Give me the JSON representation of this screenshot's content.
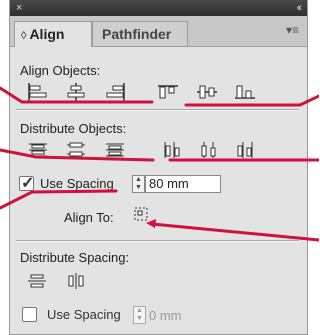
{
  "titlebar": {
    "close_glyph": "×",
    "collapse_glyph": "‹‹"
  },
  "tabs": [
    {
      "label": "Align",
      "arrows": "◊",
      "active": true
    },
    {
      "label": "Pathfinder",
      "active": false
    }
  ],
  "panel_menu_glyph": "▾≡",
  "align_objects": {
    "label": "Align Objects:",
    "icons": [
      "align-left-edges-icon",
      "align-horizontal-centers-icon",
      "align-right-edges-icon",
      "align-top-edges-icon",
      "align-vertical-centers-icon",
      "align-bottom-edges-icon"
    ]
  },
  "distribute_objects": {
    "label": "Distribute Objects:",
    "icons": [
      "distribute-top-edges-icon",
      "distribute-vertical-centers-icon",
      "distribute-bottom-edges-icon",
      "distribute-left-edges-icon",
      "distribute-horizontal-centers-icon",
      "distribute-right-edges-icon"
    ],
    "use_spacing": {
      "label": "Use Spacing",
      "checked": true,
      "value": "80 mm"
    }
  },
  "align_to": {
    "label": "Align To:",
    "icon": "align-to-selection-icon"
  },
  "distribute_spacing": {
    "label": "Distribute Spacing:",
    "icons": [
      "distribute-vertical-space-icon",
      "distribute-horizontal-space-icon"
    ],
    "use_spacing": {
      "label": "Use Spacing",
      "checked": false,
      "value": "0 mm"
    }
  },
  "colors": {
    "annotation": "#d0113c",
    "panel_bg": "#e3e3e3",
    "titlebar": "#3a3a3a"
  }
}
